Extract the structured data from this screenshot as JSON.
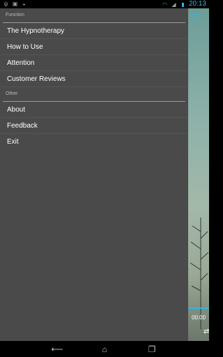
{
  "status_bar": {
    "time": "20:13",
    "icons": [
      "usb-icon",
      "image-icon",
      "android-icon",
      "wifi-icon",
      "signal-icon",
      "battery-icon"
    ]
  },
  "drawer": {
    "sections": [
      {
        "header": "Function",
        "items": [
          "The Hypnotherapy",
          "How to Use",
          "Attention",
          "Customer Reviews"
        ]
      },
      {
        "header": "Other",
        "items": [
          "About",
          "Feedback",
          "Exit"
        ]
      }
    ]
  },
  "player": {
    "elapsed": "00:00"
  },
  "colors": {
    "accent": "#33b5e5",
    "drawer_bg": "#4a4a4a"
  }
}
